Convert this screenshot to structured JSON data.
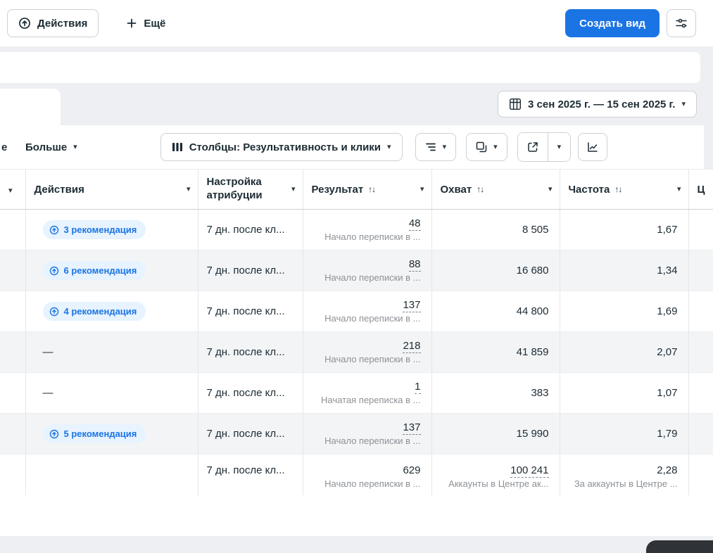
{
  "topbar": {
    "actions_label": "Действия",
    "more_label": "Ещё",
    "create_view_label": "Создать вид"
  },
  "tabs_row": {
    "date_range": "3 сен 2025 г. — 15 сен 2025 г."
  },
  "toolbar": {
    "partial_label": "е",
    "more_label": "Больше",
    "columns_label": "Столбцы: Результативность и клики"
  },
  "table": {
    "headers": {
      "actions": "Действия",
      "attribution": "Настройка атрибуции",
      "result": "Результат",
      "reach": "Охват",
      "frequency": "Частота",
      "cut_right": "Ц"
    },
    "rows": [
      {
        "action_badge": "3 рекомендация",
        "attribution": "7 дн. после кл...",
        "result": "48",
        "result_sub": "Начало переписки в ...",
        "reach": "8 505",
        "frequency": "1,67"
      },
      {
        "action_badge": "6 рекомендация",
        "attribution": "7 дн. после кл...",
        "result": "88",
        "result_sub": "Начало переписки в ...",
        "reach": "16 680",
        "frequency": "1,34"
      },
      {
        "action_badge": "4 рекомендация",
        "attribution": "7 дн. после кл...",
        "result": "137",
        "result_sub": "Начало переписки в ...",
        "reach": "44 800",
        "frequency": "1,69"
      },
      {
        "action_dash": "—",
        "attribution": "7 дн. после кл...",
        "result": "218",
        "result_sub": "Начало переписки в ...",
        "reach": "41 859",
        "frequency": "2,07"
      },
      {
        "action_dash": "—",
        "attribution": "7 дн. после кл...",
        "result": "1",
        "result_sub": "Начатая переписка в ...",
        "reach": "383",
        "frequency": "1,07"
      },
      {
        "action_badge": "5 рекомендация",
        "attribution": "7 дн. после кл...",
        "result": "137",
        "result_sub": "Начало переписки в ...",
        "reach": "15 990",
        "frequency": "1,79"
      }
    ],
    "totals": {
      "attribution": "7 дн. после кл...",
      "result": "629",
      "result_sub": "Начало переписки в ...",
      "reach": "100 241",
      "reach_sub": "Аккаунты в Центре ак...",
      "frequency": "2,28",
      "frequency_sub": "За аккаунты в Центре ..."
    }
  },
  "icons": {
    "actions": "boost-arrow-in-circle",
    "more": "plus",
    "settings": "sliders",
    "date": "grid-calendar",
    "columns": "three-vertical-bars",
    "breakdown": "stacked-rows",
    "reports": "overlapping-squares",
    "export": "arrow-out-of-box",
    "charts": "line-chart",
    "sort": "↑↓",
    "caret": "▾"
  },
  "colors": {
    "accent_blue": "#1b74e4",
    "badge_bg": "#e7f3ff",
    "badge_text": "#1b74e4",
    "subtext_gray": "#8d9196",
    "page_bg": "#edeff2"
  }
}
